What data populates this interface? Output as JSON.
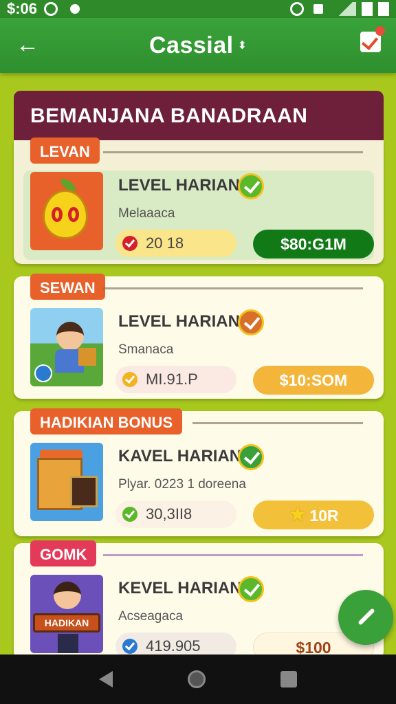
{
  "status_bar": {
    "time": "$:06"
  },
  "app_bar": {
    "title": "Cassial"
  },
  "section": {
    "title": "BEMANJANA BANADRAAN"
  },
  "cards": [
    {
      "tag": "LEVAN",
      "tag_color": "#e8602a",
      "title": "LEVEL HARIAN",
      "verify_color": "#5ab82a",
      "subtitle": "Melaaaca",
      "stat": "20 18",
      "stat_icon_color": "#d5202a",
      "stat_bg": "#fbe58a",
      "price": "$80:G1M",
      "price_color": "#117a17",
      "inner_bg": "#d9ebc4"
    },
    {
      "tag": "SEWAN",
      "tag_color": "#e8602a",
      "title": "LEVEL HARIAN",
      "verify_color": "#d8702a",
      "subtitle": "Smanaca",
      "stat": "MI.91.P",
      "stat_icon_color": "#f3b21f",
      "stat_bg": "#fbe9e4",
      "price": "$10:SOM",
      "price_color": "#f3b53a",
      "inner_bg": "#fffbe9"
    },
    {
      "tag": "HADIKIAN BONUS",
      "tag_color": "#e8602a",
      "title": "KAVEL HARIAN",
      "verify_color": "#3aa03a",
      "subtitle": "Plyar. 0223 1 doreena",
      "stat": "30,3II8",
      "stat_icon_color": "#5ab82a",
      "stat_bg": "#fbf1e4",
      "price": "10R",
      "price_color": "#f3c03a",
      "inner_bg": "#fffbe9"
    },
    {
      "tag": "GOMK",
      "tag_color": "#e43a5a",
      "title": "KEVEL HARIAN",
      "verify_color": "#5ab82a",
      "subtitle": "Acseagaca",
      "stat": "419.905",
      "stat_icon_color": "#2a7ad0",
      "stat_bg": "#f1ebe4",
      "price": "$100",
      "price_color": "#fff6e0",
      "inner_bg": "#fffbe9"
    }
  ],
  "thumb_labels": {
    "hero_banner": "HADIKAN"
  }
}
